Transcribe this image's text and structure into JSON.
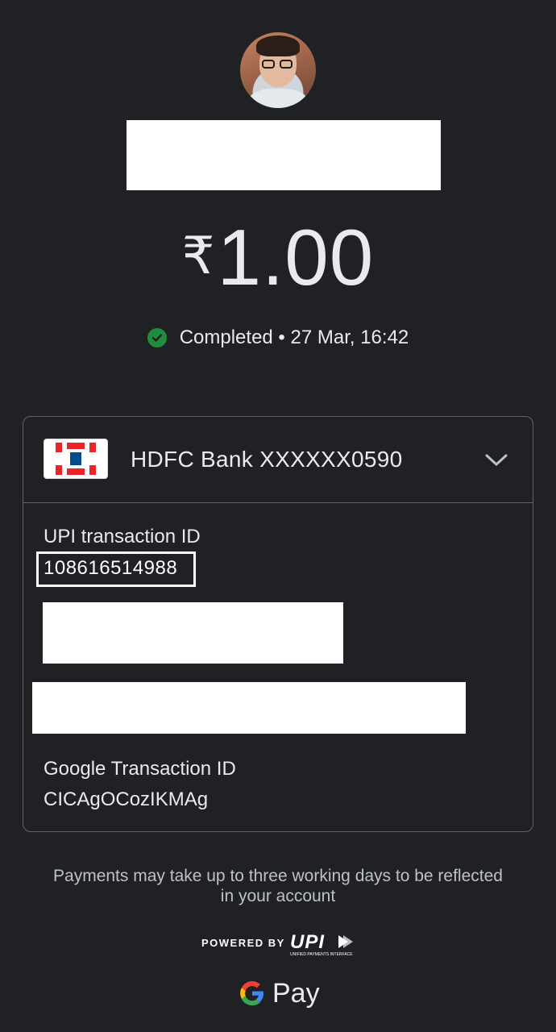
{
  "payee": {
    "avatar_icon": "user-avatar-photo"
  },
  "amount": {
    "currency": "₹",
    "value": "1.00"
  },
  "status": {
    "icon": "check-circle-icon",
    "text": "Completed • 27 Mar, 16:42",
    "color": "#1e8e3e"
  },
  "details": {
    "bank": {
      "logo_icon": "hdfc-bank-logo",
      "name": "HDFC Bank XXXXXX0590",
      "expand_icon": "chevron-down-icon"
    },
    "upi_transaction_id_label": "UPI transaction ID",
    "upi_transaction_id": "108616514988",
    "google_transaction_id_label": "Google Transaction ID",
    "google_transaction_id": "CICAgOCozIKMAg"
  },
  "footer": {
    "note": "Payments may take up to three working days to be reflected in your account",
    "powered_by": "POWERED BY",
    "upi_logo_text": "UPI",
    "upi_logo_subtext": "UNIFIED PAYMENTS INTERFACE",
    "gpay_text": "Pay"
  },
  "colors": {
    "background": "#202124",
    "card_border": "#5f6368",
    "hdfc_red": "#ed232a",
    "hdfc_blue": "#004c8f"
  }
}
